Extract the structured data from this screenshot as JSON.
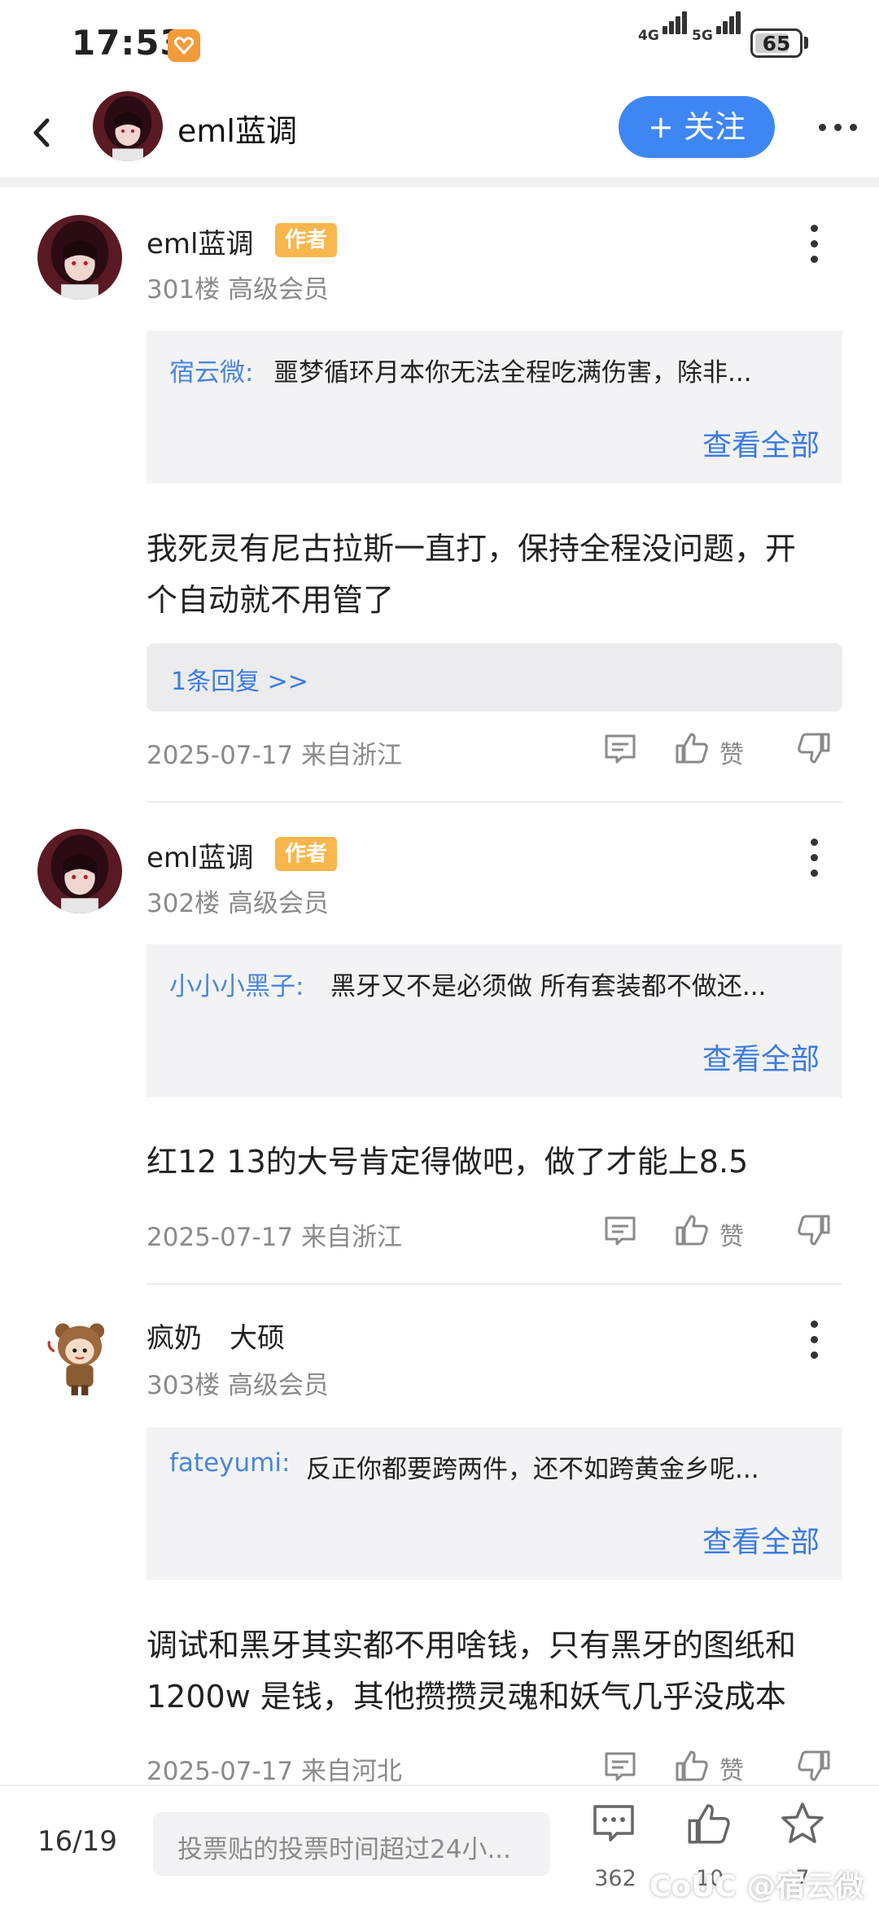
{
  "status_bar": {
    "time": "17:53",
    "net1": "4G",
    "net2": "5G",
    "battery": "65"
  },
  "header": {
    "title": "eml蓝调",
    "follow_label": "+ 关注"
  },
  "posts": [
    {
      "username": "eml蓝调",
      "badge": "作者",
      "meta": "301楼 高级会员",
      "quote_user": "宿云微:",
      "quote_text": "噩梦循环月本你无法全程吃满伤害，除非...",
      "quote_more": "查看全部",
      "body_line1": "我死灵有尼古拉斯一直打，保持全程没问题，开",
      "body_line2": "个自动就不用管了",
      "reply_label": "1条回复 >>",
      "date": "2025-07-17 来自浙江",
      "like_label": "赞"
    },
    {
      "username": "eml蓝调",
      "badge": "作者",
      "meta": "302楼 高级会员",
      "quote_user": "小小小黑子:",
      "quote_text": "黑牙又不是必须做 所有套装都不做还...",
      "quote_more": "查看全部",
      "body_line1": "红12 13的大号肯定得做吧，做了才能上8.5",
      "date": "2025-07-17 来自浙江",
      "like_label": "赞"
    },
    {
      "username": "疯奶　大硕",
      "meta": "303楼 高级会员",
      "quote_user": "fateyumi:",
      "quote_text": "反正你都要跨两件，还不如跨黄金乡呢...",
      "quote_more": "查看全部",
      "body_line1": "调试和黑牙其实都不用啥钱，只有黑牙的图纸和",
      "body_line2": "1200w 是钱，其他攒攒灵魂和妖气几乎没成本",
      "date": "2025-07-17 来自河北",
      "like_label": "赞"
    }
  ],
  "bottom_bar": {
    "page": "16/19",
    "input_placeholder": "投票贴的投票时间超过24小...",
    "comment_count": "362",
    "like_count": "10",
    "star_count": "7"
  },
  "watermark": "@宿云微",
  "colors": {
    "accent": "#3f86f5",
    "link": "#3d7be0",
    "badge": "#f8b64c"
  },
  "icons": [
    "back-arrow-icon",
    "more-icon",
    "comment-icon",
    "thumb-up-icon",
    "thumb-down-icon",
    "star-icon"
  ]
}
